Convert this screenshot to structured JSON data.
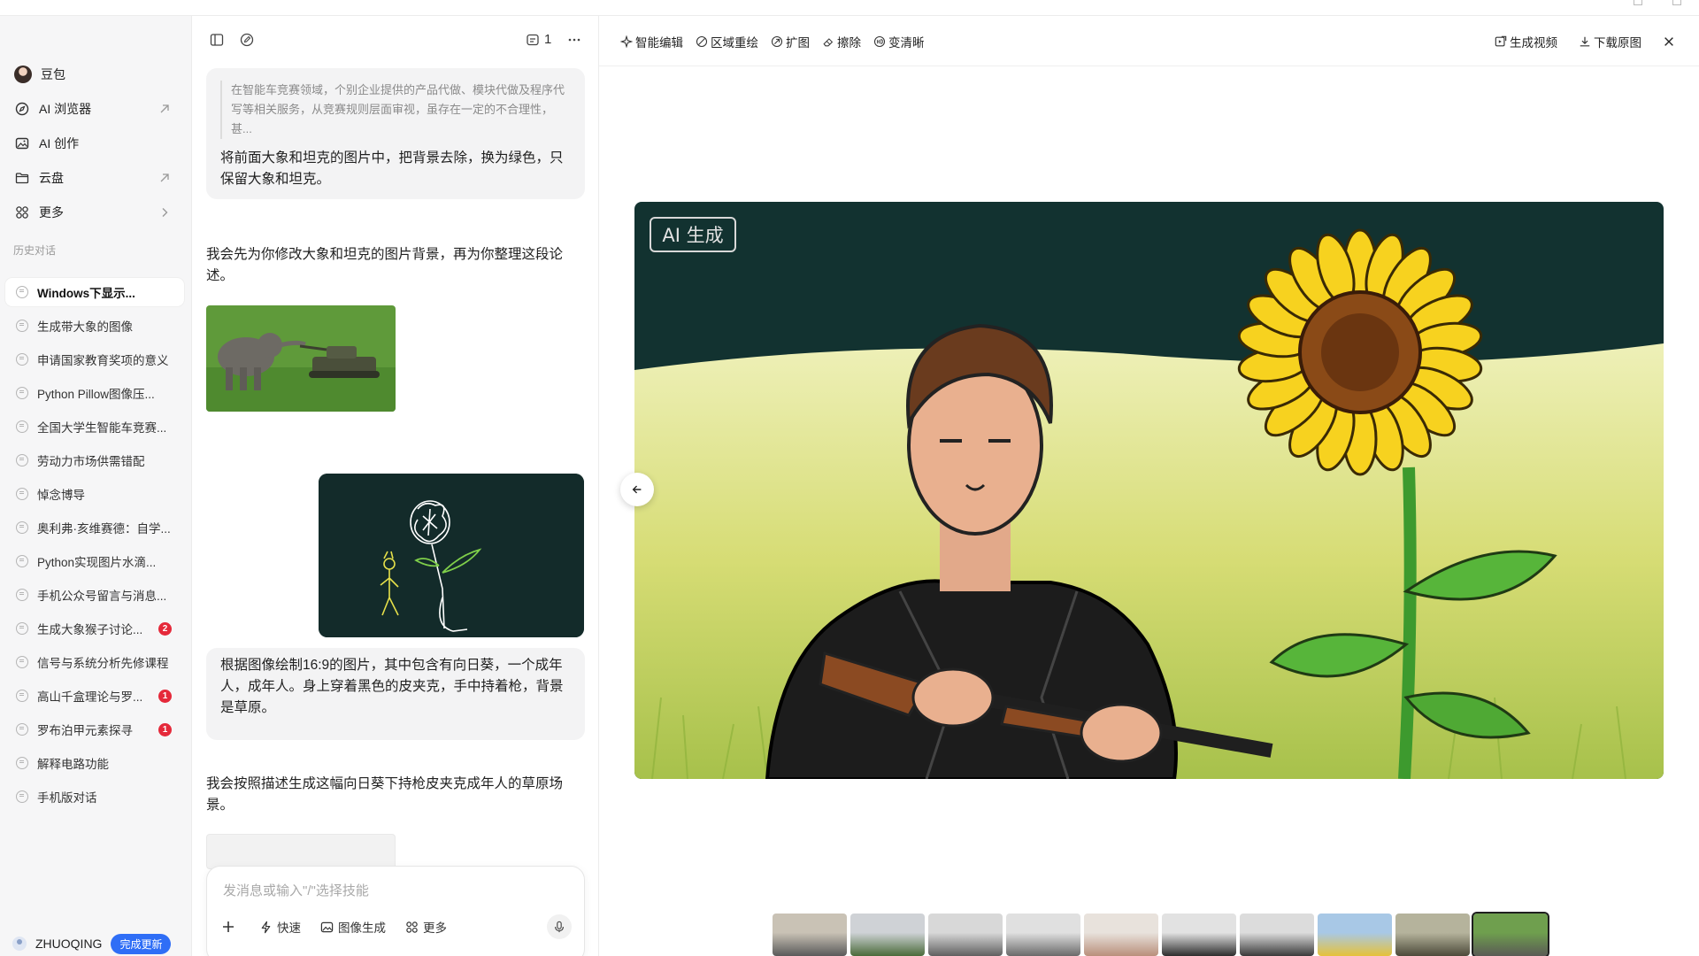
{
  "sidebar": {
    "profile_label": "豆包",
    "nav": [
      {
        "label": "AI 浏览器",
        "icon": "compass-icon",
        "trail": "external-arrow"
      },
      {
        "label": "AI 创作",
        "icon": "image-icon",
        "trail": ""
      },
      {
        "label": "云盘",
        "icon": "folder-icon",
        "trail": "external-arrow"
      },
      {
        "label": "更多",
        "icon": "grid-icon",
        "trail": "chevron"
      }
    ],
    "history_label": "历史对话",
    "history": [
      {
        "label": "Windows下显示...",
        "active": true,
        "badge": ""
      },
      {
        "label": "生成带大象的图像",
        "active": false,
        "badge": ""
      },
      {
        "label": "申请国家教育奖项的意义",
        "active": false,
        "badge": ""
      },
      {
        "label": "Python Pillow图像压...",
        "active": false,
        "badge": ""
      },
      {
        "label": "全国大学生智能车竞赛...",
        "active": false,
        "badge": ""
      },
      {
        "label": "劳动力市场供需错配",
        "active": false,
        "badge": ""
      },
      {
        "label": "悼念博导",
        "active": false,
        "badge": ""
      },
      {
        "label": "奥利弗·亥维赛德：自学...",
        "active": false,
        "badge": ""
      },
      {
        "label": "Python实现图片水滴...",
        "active": false,
        "badge": ""
      },
      {
        "label": "手机公众号留言与消息...",
        "active": false,
        "badge": ""
      },
      {
        "label": "生成大象猴子讨论...",
        "active": false,
        "badge": "2"
      },
      {
        "label": "信号与系统分析先修课程",
        "active": false,
        "badge": ""
      },
      {
        "label": "高山千盒理论与罗...",
        "active": false,
        "badge": "1"
      },
      {
        "label": "罗布泊甲元素探寻",
        "active": false,
        "badge": "1"
      },
      {
        "label": "解释电路功能",
        "active": false,
        "badge": ""
      },
      {
        "label": "手机版对话",
        "active": false,
        "badge": ""
      }
    ],
    "user_name": "ZHUOQING",
    "update_label": "完成更新"
  },
  "chat": {
    "count": "1",
    "quote": "在智能车竞赛领域，个别企业提供的产品代做、模块代做及程序代写等相关服务，从竞赛规则层面审视，虽存在一定的不合理性，甚...",
    "msg1": "将前面大象和坦克的图片中，把背景去除，换为绿色，只保留大象和坦克。",
    "reply1": "我会先为你修改大象和坦克的图片背景，再为你整理这段论述。",
    "msg2": "根据图像绘制16:9的图片，其中包含有向日葵，一个成年人，成年人。身上穿着黑色的皮夹克，手中持着枪，背景是草原。",
    "reply2": "我会按照描述生成这幅向日葵下持枪皮夹克成年人的草原场景。",
    "composer_placeholder": "发消息或输入\"/\"选择技能",
    "composer_actions": [
      {
        "label": "快速",
        "icon": "bolt-icon"
      },
      {
        "label": "图像生成",
        "icon": "image-gen-icon"
      },
      {
        "label": "更多",
        "icon": "grid-icon"
      }
    ]
  },
  "viewer": {
    "tools_left": [
      "智能编辑",
      "区域重绘",
      "扩图",
      "擦除",
      "变清晰"
    ],
    "tools_right": [
      "生成视频",
      "下载原图"
    ],
    "watermark": "AI 生成",
    "film_count": 10,
    "film_selected": 9
  },
  "colors": {
    "accent": "#2f6ef6",
    "badge": "#e5293a",
    "sky": "#123230",
    "grass": "#d8dc7a"
  }
}
